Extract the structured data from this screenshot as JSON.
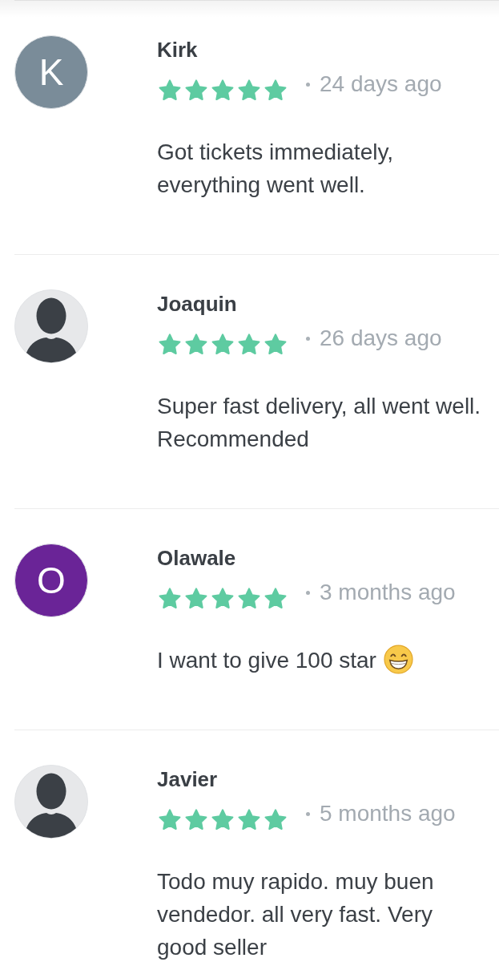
{
  "reviews": [
    {
      "avatar": {
        "kind": "initial",
        "letter": "K",
        "color": "#7a8c99"
      },
      "name": "Kirk",
      "stars": 5,
      "date": "24 days ago",
      "text": "Got tickets immediately, everything went well."
    },
    {
      "avatar": {
        "kind": "silhouette"
      },
      "name": "Joaquin",
      "stars": 5,
      "date": "26 days ago",
      "text": "Super fast delivery, all went well. Recommended"
    },
    {
      "avatar": {
        "kind": "initial",
        "letter": "O",
        "color": "#6a2497"
      },
      "name": "Olawale",
      "stars": 5,
      "date": "3 months ago",
      "text": "I want to give 100 star",
      "emoji": true
    },
    {
      "avatar": {
        "kind": "silhouette"
      },
      "name": "Javier",
      "stars": 5,
      "date": "5 months ago",
      "text": "Todo muy rapido. muy buen vendedor. all very fast. Very good seller"
    }
  ]
}
